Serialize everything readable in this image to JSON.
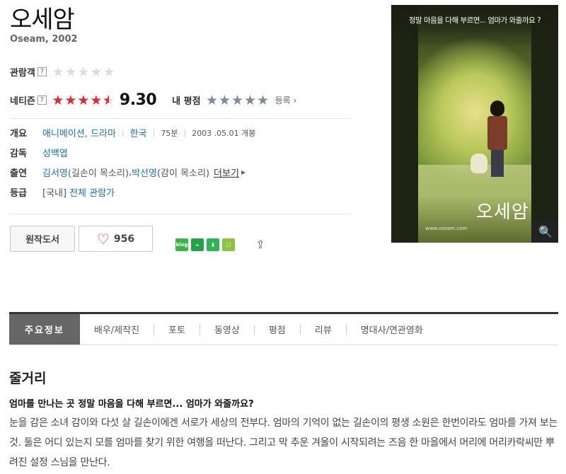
{
  "movie": {
    "title": "오세암",
    "subtitle": "Oseam, 2002"
  },
  "ratings": {
    "audience_label": "관람객",
    "audience_stars": 0,
    "netizen_label": "네티즌",
    "netizen_score": "9.30",
    "netizen_stars": 4.5,
    "my_label": "내 평점",
    "register_label": "등록",
    "help_mark": "?"
  },
  "info": {
    "overview_key": "개요",
    "genres": "애니메이션, 드라마",
    "country": "한국",
    "runtime": "75분",
    "release": "2003 .05.01 개봉",
    "director_key": "감독",
    "director": "성백엽",
    "cast_key": "출연",
    "cast1_name": "김서영",
    "cast1_role": "(길손이 목소리)",
    "cast2_name": "박선영",
    "cast2_role": "(감이 목소리)",
    "more_label": "더보기",
    "grade_key": "등급",
    "grade_region": "[국내]",
    "grade_value": "전체 관람가"
  },
  "actions": {
    "book_label": "원작도서",
    "like_count": "956",
    "share_icons": [
      "blog-icon",
      "cafe-icon",
      "bookmark-icon",
      "memo-icon",
      "share-icon"
    ],
    "blog_text": "blog"
  },
  "poster": {
    "tagline": "정말 마음을 다해 부르면... 엄마가 와줄까요 ?",
    "title": "오세암",
    "url": "www.oseam.com"
  },
  "tabs": [
    "주요정보",
    "배우/제작진",
    "포토",
    "동영상",
    "평점",
    "리뷰",
    "명대사/연관영화"
  ],
  "story": {
    "section_title": "줄거리",
    "headline": "엄마를 만나는 곳 정말 마음을 다해 부르면... 엄마가 와줄까요?",
    "body": "눈을 감은 소녀 감이와 다섯 살 길손이에겐 서로가 세상의 전부다. 엄마의 기억이 없는 길손이의 평생 소원은 한번이라도 엄마를 가져 보는 것. 둘은 어디 있는지 모를 엄마를 찾기 위한 여행을 떠난다. 그리고 막 추운 겨울이 시작되려는 즈음 한 마을에서 머리에 머리카락씨만 뿌려진 설정 스님을 만난다."
  },
  "colors": {
    "star_red": "#e8262f",
    "link_blue": "#1b6fb9",
    "tab_active_bg": "#666666"
  }
}
